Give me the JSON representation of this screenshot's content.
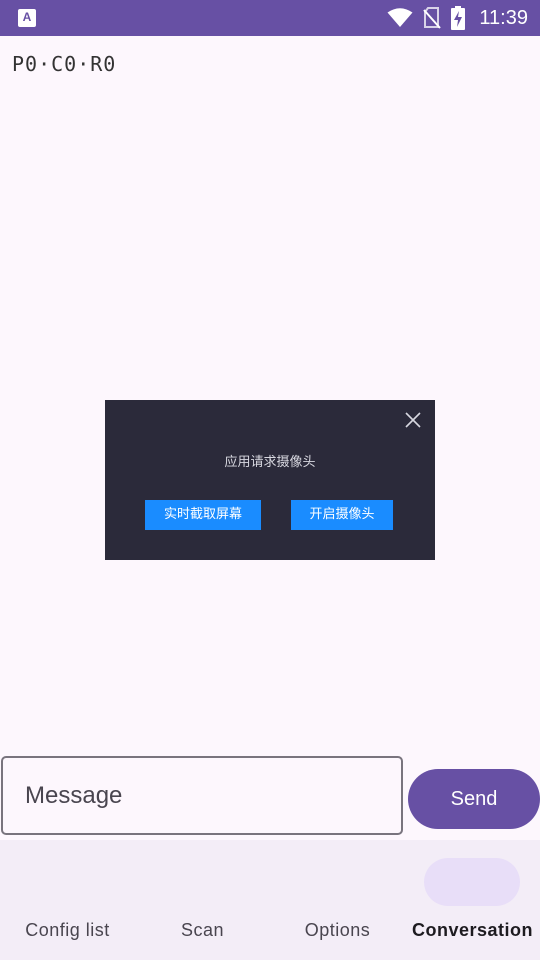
{
  "status_bar": {
    "app_icon_letter": "A",
    "time": "11:39",
    "icons": [
      "wifi-icon",
      "no-sim-icon",
      "battery-charging-icon"
    ]
  },
  "position_text": "P0·C0·R0",
  "dialog": {
    "message": "应用请求摄像头",
    "button_left": "实时截取屏幕",
    "button_right": "开启摄像头"
  },
  "composer": {
    "message_placeholder": "Message",
    "send_label": "Send"
  },
  "bottom_nav": {
    "items": [
      {
        "label": "Config list"
      },
      {
        "label": "Scan"
      },
      {
        "label": "Options"
      },
      {
        "label": "Conversation",
        "active": true
      }
    ]
  },
  "colors": {
    "primary": "#6750a4",
    "background": "#fdf7fd",
    "dialog_bg": "#2b2a3a",
    "dialog_button": "#1a8cff",
    "nav_bg": "#f3edf7",
    "nav_indicator": "#e8def8"
  }
}
